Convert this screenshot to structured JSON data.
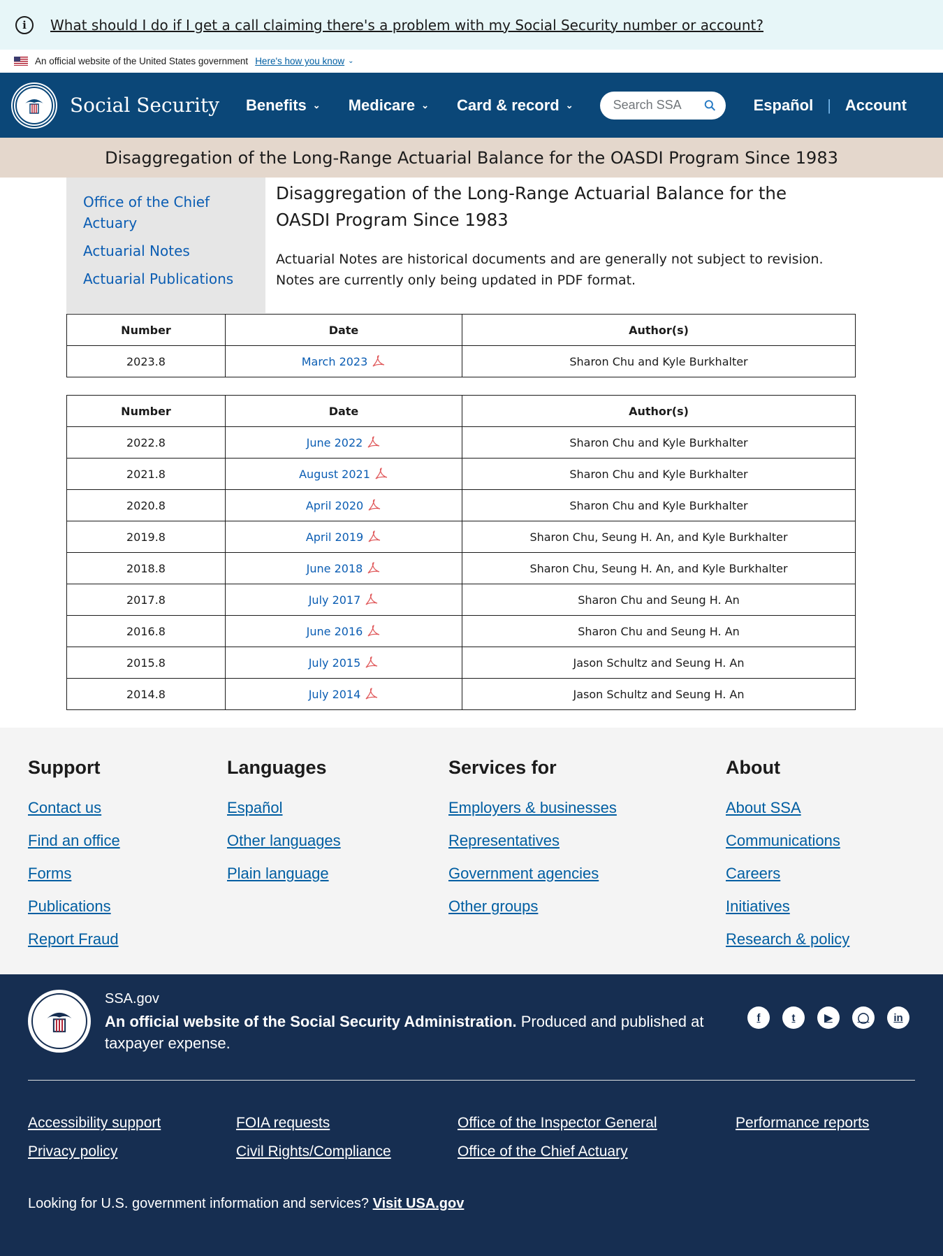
{
  "alert": {
    "text": "What should I do if I get a call claiming there's a problem with my Social Security number or account?"
  },
  "gov_banner": {
    "text": "An official website of the United States government",
    "link": "Here's how you know"
  },
  "header": {
    "brand": "Social Security",
    "nav": [
      "Benefits",
      "Medicare",
      "Card & record"
    ],
    "search_placeholder": "Search SSA",
    "links": [
      "Español",
      "Account"
    ]
  },
  "title_band": "Disaggregation of the Long-Range Actuarial Balance for the OASDI Program Since 1983",
  "sidebar": [
    "Office of the Chief Actuary",
    "Actuarial Notes",
    "Actuarial Publications"
  ],
  "main": {
    "heading": "Disaggregation of the Long-Range Actuarial Balance for the OASDI Program Since 1983",
    "note": "Actuarial Notes are historical documents and are generally not subject to revision. Notes are currently only being updated in PDF format."
  },
  "table_headers": [
    "Number",
    "Date",
    "Author(s)"
  ],
  "table1": [
    {
      "number": "2023.8",
      "date": "March 2023",
      "authors": "Sharon Chu and Kyle Burkhalter"
    }
  ],
  "table2": [
    {
      "number": "2022.8",
      "date": "June 2022",
      "authors": "Sharon Chu and Kyle Burkhalter"
    },
    {
      "number": "2021.8",
      "date": "August 2021",
      "authors": "Sharon Chu and Kyle Burkhalter"
    },
    {
      "number": "2020.8",
      "date": "April 2020",
      "authors": "Sharon Chu and Kyle Burkhalter"
    },
    {
      "number": "2019.8",
      "date": "April 2019",
      "authors": "Sharon Chu, Seung H. An, and Kyle Burkhalter"
    },
    {
      "number": "2018.8",
      "date": "June 2018",
      "authors": "Sharon Chu, Seung H. An, and Kyle Burkhalter"
    },
    {
      "number": "2017.8",
      "date": "July 2017",
      "authors": "Sharon Chu and Seung H. An"
    },
    {
      "number": "2016.8",
      "date": "June 2016",
      "authors": "Sharon Chu and Seung H. An"
    },
    {
      "number": "2015.8",
      "date": "July 2015",
      "authors": "Jason Schultz and Seung H. An"
    },
    {
      "number": "2014.8",
      "date": "July 2014",
      "authors": "Jason Schultz and Seung H. An"
    }
  ],
  "footer_columns": [
    {
      "title": "Support",
      "links": [
        "Contact us",
        "Find an office",
        "Forms",
        "Publications",
        "Report Fraud"
      ]
    },
    {
      "title": "Languages",
      "links": [
        "Español",
        "Other languages",
        "Plain language"
      ]
    },
    {
      "title": "Services for",
      "links": [
        "Employers & businesses",
        "Representatives",
        "Government agencies",
        "Other groups"
      ]
    },
    {
      "title": "About",
      "links": [
        "About SSA",
        "Communications",
        "Careers",
        "Initiatives",
        "Research & policy"
      ]
    }
  ],
  "footer": {
    "site": "SSA.gov",
    "official_bold": "An official website of the Social Security Administration.",
    "official_rest": " Produced and published at taxpayer expense.",
    "socials": [
      "facebook-icon",
      "twitter-icon",
      "youtube-icon",
      "instagram-icon",
      "linkedin-icon"
    ],
    "links": [
      "Accessibility support",
      "Privacy policy",
      "FOIA requests",
      "Civil Rights/Compliance",
      "Office of the Inspector General",
      "Office of the Chief Actuary",
      "Performance reports"
    ],
    "usa_text": "Looking for U.S. government information and services?",
    "usa_link": "Visit USA.gov"
  },
  "colors": {
    "header_blue": "#0b4778",
    "footer_navy": "#162e51",
    "title_band": "#e4d7cc",
    "link_blue": "#0b5db3",
    "alert_bg": "#e7f6f8"
  }
}
